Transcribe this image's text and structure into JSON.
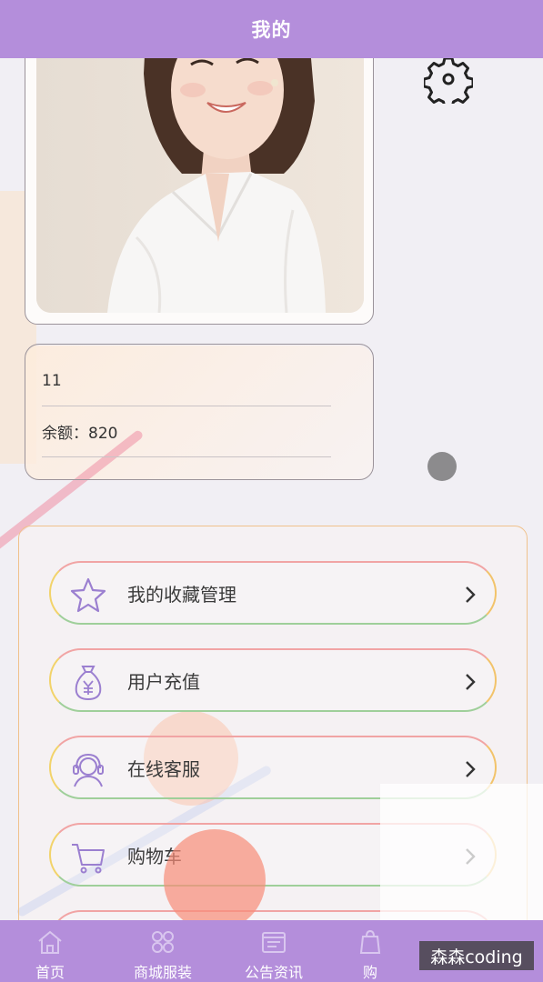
{
  "header": {
    "title": "我的"
  },
  "profile": {
    "name": "11",
    "balance_text": "余额：820"
  },
  "menu": {
    "items": [
      {
        "label": "我的收藏管理",
        "icon": "star-icon"
      },
      {
        "label": "用户充值",
        "icon": "money-bag-icon"
      },
      {
        "label": "在线客服",
        "icon": "headset-agent-icon"
      },
      {
        "label": "购物车",
        "icon": "cart-icon"
      }
    ]
  },
  "tabbar": {
    "tabs": [
      {
        "label": "首页",
        "icon": "home-icon"
      },
      {
        "label": "商城服装",
        "icon": "grid-icon"
      },
      {
        "label": "公告资讯",
        "icon": "news-icon"
      },
      {
        "label": "购",
        "icon": "bag-icon"
      }
    ]
  },
  "watermark": {
    "text": "森森coding"
  },
  "colors": {
    "header_bg": "#b48edb",
    "page_bg": "#f1eff4",
    "icon_purple": "#9b7fd0"
  }
}
